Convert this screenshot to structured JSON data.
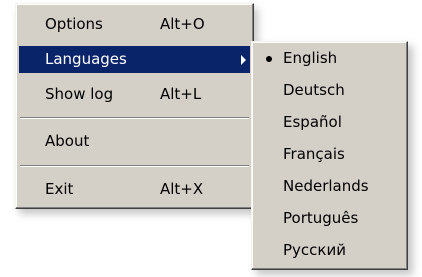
{
  "main_menu": {
    "items": [
      {
        "label": "Options",
        "shortcut": "Alt+O"
      },
      {
        "label": "Languages",
        "shortcut": "",
        "submenu_arrow": "right-triangle"
      },
      {
        "label": "Show log",
        "shortcut": "Alt+L"
      },
      {
        "label": "About",
        "shortcut": ""
      },
      {
        "label": "Exit",
        "shortcut": "Alt+X"
      }
    ],
    "selected_item": "Languages",
    "highlight_color": "#0a246a",
    "background_color": "#d4d0c8"
  },
  "languages_menu": {
    "items": [
      {
        "label": "English",
        "checked": true
      },
      {
        "label": "Deutsch",
        "checked": false
      },
      {
        "label": "Español",
        "checked": false
      },
      {
        "label": "Français",
        "checked": false
      },
      {
        "label": "Nederlands",
        "checked": false
      },
      {
        "label": "Português",
        "checked": false
      },
      {
        "label": "Русский",
        "checked": false
      }
    ]
  }
}
